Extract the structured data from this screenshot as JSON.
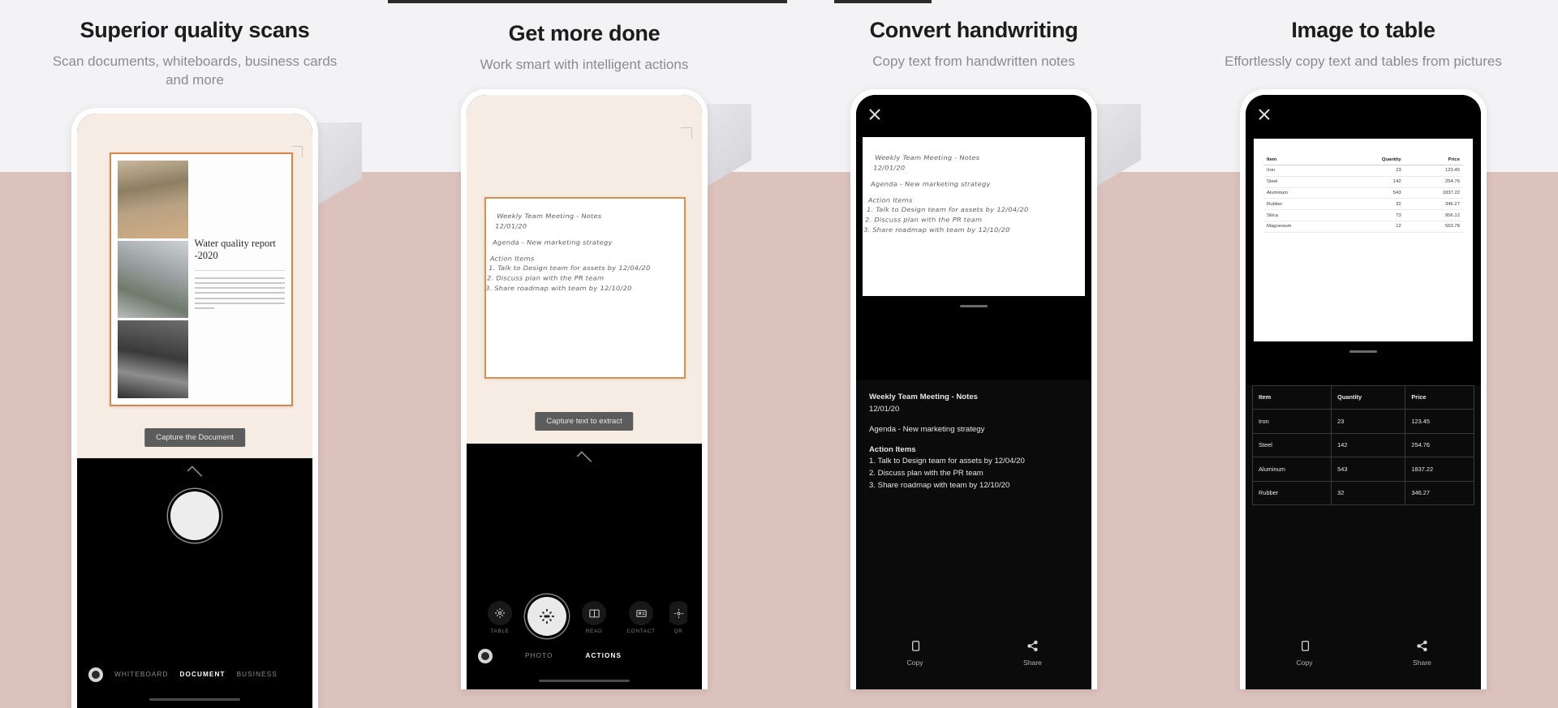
{
  "theme": {
    "bg_top": "#f3f3f5",
    "bg_bottom": "#dcc2bd",
    "accent_orange": "#d9864a",
    "title_color": "#1c1c1c",
    "subtitle_color": "#8b8b90",
    "screen_black": "#000000"
  },
  "panels": [
    {
      "title": "Superior quality scans",
      "subtitle": "Scan documents, whiteboards, business cards and more",
      "tooltip": "Capture the Document",
      "document": {
        "title": "Water quality report -2020",
        "photos": [
          "landscape-photo",
          "highway-interchange-photo",
          "dam-structure-photo"
        ]
      },
      "camera_modes": [
        {
          "label": "WHITEBOARD",
          "active": false
        },
        {
          "label": "DOCUMENT",
          "active": true
        },
        {
          "label": "BUSINESS",
          "active": false
        }
      ],
      "gallery_icon": "gallery-icon",
      "shutter": "shutter-button",
      "chevron": "chevron-up-icon"
    },
    {
      "title": "Get more done",
      "subtitle": "Work smart with intelligent actions",
      "tooltip": "Capture text to extract",
      "note": {
        "line1": "Weekly Team Meeting - Notes",
        "line2": "12/01/20",
        "line3": "Agenda - New marketing strategy",
        "line4": "Action Items",
        "line5": "1. Talk to Design team for assets by 12/04/20",
        "line6": "2. Discuss plan with the PR team",
        "line7": "3. Share roadmap with team by 12/10/20"
      },
      "actions": [
        {
          "label": "TABLE",
          "icon": "table-scan-icon",
          "active": false
        },
        {
          "label": "",
          "icon": "text-scan-icon",
          "active": true
        },
        {
          "label": "READ",
          "icon": "read-icon",
          "active": false
        },
        {
          "label": "CONTACT",
          "icon": "contact-card-icon",
          "active": false
        },
        {
          "label": "QR",
          "icon": "qr-icon",
          "active": false
        }
      ],
      "camera_modes": [
        {
          "label": "PHOTO",
          "active": false
        },
        {
          "label": "ACTIONS",
          "active": true
        }
      ],
      "gallery_icon": "gallery-icon",
      "chevron": "chevron-up-icon"
    },
    {
      "title": "Convert handwriting",
      "subtitle": "Copy text from handwritten notes",
      "close_icon": "close-icon",
      "note": {
        "line1": "Weekly Team Meeting - Notes",
        "line2": "12/01/20",
        "line3": "Agenda - New marketing strategy",
        "line4": "Action Items",
        "line5": "1. Talk to Design team for assets by 12/04/20",
        "line6": "2. Discuss plan with the PR team",
        "line7": "3. Share roadmap with team by 12/10/20"
      },
      "extracted": {
        "heading": "Weekly Team Meeting - Notes",
        "date": "12/01/20",
        "agenda": "Agenda - New marketing strategy",
        "action_heading": "Action Items",
        "items": [
          "1. Talk to Design team for assets by 12/04/20",
          "2. Discuss plan with the PR team",
          "3. Share roadmap with team by 12/10/20"
        ]
      },
      "footer": [
        {
          "label": "Copy",
          "icon": "copy-icon"
        },
        {
          "label": "Share",
          "icon": "share-icon"
        }
      ]
    },
    {
      "title": "Image to table",
      "subtitle": "Effortlessly copy text and tables from pictures",
      "close_icon": "close-icon",
      "source_table": {
        "columns": [
          "Item",
          "Quantity",
          "Price"
        ],
        "rows": [
          [
            "Iron",
            "23",
            "123.45"
          ],
          [
            "Steel",
            "142",
            "254.76"
          ],
          [
            "Aluminum",
            "543",
            "1837.22"
          ],
          [
            "Rubber",
            "32",
            "346.27"
          ],
          [
            "Silica",
            "73",
            "956.12"
          ],
          [
            "Magnesium",
            "12",
            "563.78"
          ]
        ]
      },
      "output_table": {
        "columns": [
          "Item",
          "Quantity",
          "Price"
        ],
        "rows": [
          [
            "Iron",
            "23",
            "123.45"
          ],
          [
            "Steel",
            "142",
            "254.76"
          ],
          [
            "Aluminum",
            "543",
            "1837.22"
          ],
          [
            "Rubber",
            "32",
            "346.27"
          ]
        ]
      },
      "footer": [
        {
          "label": "Copy",
          "icon": "copy-icon"
        },
        {
          "label": "Share",
          "icon": "share-icon"
        }
      ]
    }
  ]
}
